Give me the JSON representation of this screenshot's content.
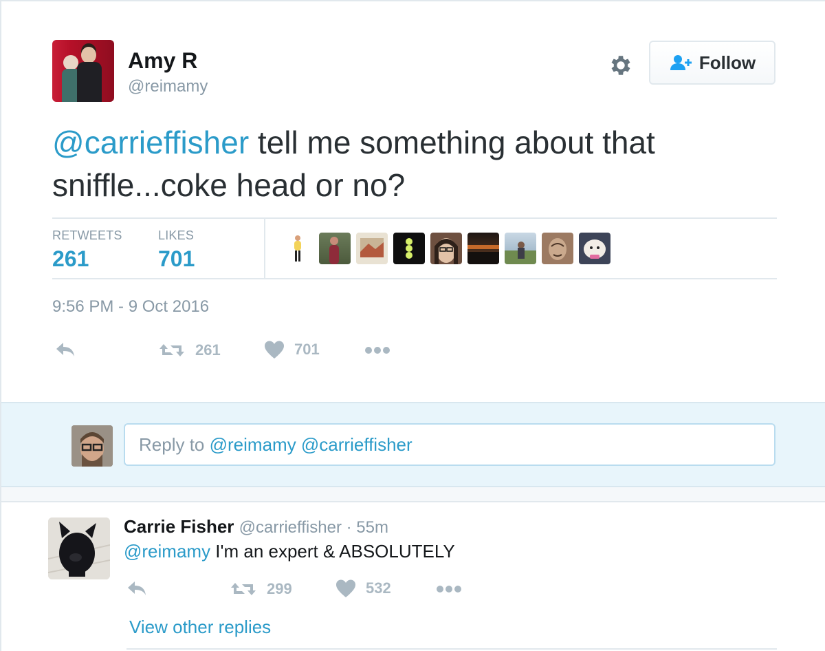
{
  "tweet": {
    "author": {
      "display_name": "Amy R",
      "username": "@reimamy"
    },
    "follow_button": {
      "label": "Follow"
    },
    "text": {
      "mention": "@carrieffisher",
      "body": " tell me something about that sniffle...coke head or no?"
    },
    "stats": {
      "retweets_label": "RETWEETS",
      "retweets_value": "261",
      "likes_label": "LIKES",
      "likes_value": "701",
      "liker_avatars": [
        "liker-avatar-1",
        "liker-avatar-2",
        "liker-avatar-3",
        "liker-avatar-4",
        "liker-avatar-5",
        "liker-avatar-6",
        "liker-avatar-7",
        "liker-avatar-8",
        "liker-avatar-9"
      ]
    },
    "timestamp": "9:56 PM - 9 Oct 2016",
    "actions": {
      "retweet_count": "261",
      "like_count": "701"
    }
  },
  "reply_box": {
    "prefix": "Reply to ",
    "mentions": "@reimamy @carrieffisher"
  },
  "reply": {
    "display_name": "Carrie Fisher",
    "username": "@carrieffisher",
    "separator": " · ",
    "time": "55m",
    "mention": "@reimamy",
    "body": " I'm an expert & ABSOLUTELY",
    "actions": {
      "retweet_count": "299",
      "like_count": "532"
    },
    "view_other_replies": "View other replies"
  },
  "colors": {
    "link": "#2b9bc9",
    "muted": "#8899a6",
    "icon": "#aab8c2",
    "reply_area_bg": "#e8f5fb"
  },
  "icons": [
    "gear-icon",
    "follow-person-icon",
    "reply-icon",
    "retweet-icon",
    "heart-icon",
    "more-icon"
  ]
}
